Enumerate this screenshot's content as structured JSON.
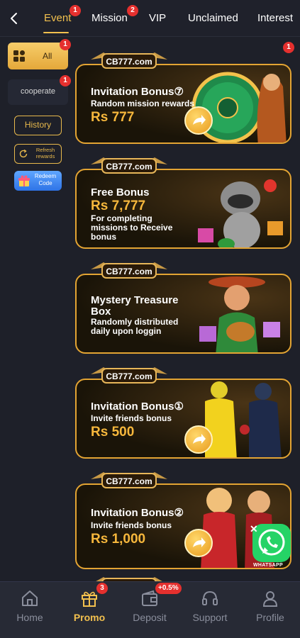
{
  "tabs": [
    {
      "label": "Event",
      "badge": "1",
      "active": true
    },
    {
      "label": "Mission",
      "badge": "2"
    },
    {
      "label": "VIP"
    },
    {
      "label": "Unclaimed"
    },
    {
      "label": "Interest"
    }
  ],
  "sidebar": {
    "all": {
      "label": "All",
      "badge": "1"
    },
    "cooperate": {
      "label": "cooperate",
      "badge": "1"
    },
    "history": "History",
    "refresh": "Refresh rewards",
    "redeem": "Redeem Code"
  },
  "logo_text": "CB777.com",
  "card_badge": "1",
  "cards": [
    {
      "title": "Invitation Bonus⑦",
      "subtitle": "Random mission rewards",
      "amount": "Rs 777"
    },
    {
      "title": "Free Bonus",
      "amount": "Rs 7,777",
      "subtitle": "For completing missions to Receive bonus"
    },
    {
      "title": "Mystery Treasure Box",
      "subtitle": "Randomly distributed daily upon loggin"
    },
    {
      "title": "Invitation Bonus①",
      "subtitle": "Invite friends bonus",
      "amount": "Rs 500"
    },
    {
      "title": "Invitation Bonus②",
      "subtitle": "Invite friends bonus",
      "amount": "Rs 1,000"
    }
  ],
  "whatsapp_label": "WHATSAPP",
  "bottom_nav": [
    {
      "label": "Home",
      "icon": "home-icon"
    },
    {
      "label": "Promo",
      "icon": "gift-icon",
      "badge": "3",
      "active": true
    },
    {
      "label": "Deposit",
      "icon": "wallet-icon",
      "badge": "+0.5%"
    },
    {
      "label": "Support",
      "icon": "headset-icon"
    },
    {
      "label": "Profile",
      "icon": "user-icon"
    }
  ],
  "colors": {
    "accent": "#f2c04e",
    "background": "#1e2029",
    "badge": "#e5302e",
    "card_border": "#e3a433"
  }
}
